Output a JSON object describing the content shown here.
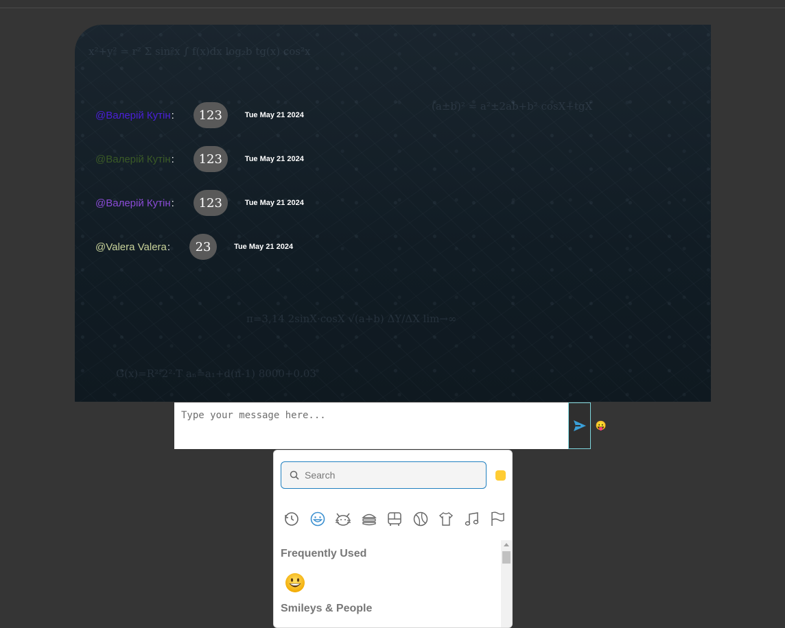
{
  "messages": [
    {
      "author": "@Валерій Кутін",
      "author_color": "#4b1fd9",
      "colon": ":",
      "text": "123",
      "time": "Tue May 21 2024"
    },
    {
      "author": "@Валерій Кутін",
      "author_color": "#3a5a26",
      "colon": ":",
      "text": "123",
      "time": "Tue May 21 2024"
    },
    {
      "author": "@Валерій Кутін",
      "author_color": "#8a4bd6",
      "colon": ":",
      "text": "123",
      "time": "Tue May 21 2024"
    },
    {
      "author": "@Valera Valera",
      "author_color": "#c9d39a",
      "colon": ":",
      "text": "23",
      "time": "Tue May 21 2024"
    }
  ],
  "composer": {
    "placeholder": "Type your message here..."
  },
  "send_button": {
    "icon": "send-icon",
    "color": "#3a9fd8"
  },
  "emoji_toggle": {
    "icon": "😛"
  },
  "emoji_picker": {
    "search_placeholder": "Search",
    "skin_tone_color": "#ffcc33",
    "categories": [
      "recent-icon",
      "smileys-icon",
      "animals-icon",
      "food-icon",
      "travel-icon",
      "activities-icon",
      "objects-icon",
      "symbols-icon",
      "flags-icon"
    ],
    "active_category": "smileys-icon",
    "sections": [
      {
        "title": "Frequently Used",
        "emojis": [
          "😃"
        ]
      },
      {
        "title": "Smileys & People",
        "emojis": []
      }
    ]
  }
}
